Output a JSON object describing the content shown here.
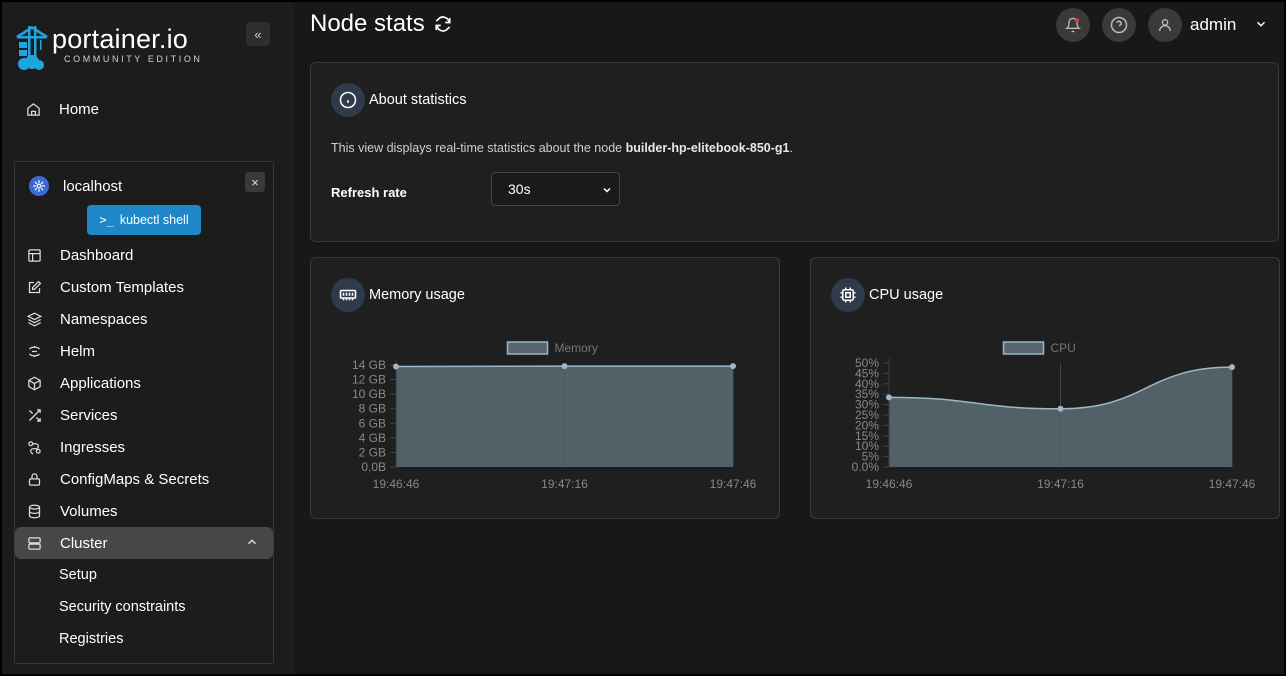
{
  "brand": {
    "name": "portainer.io",
    "edition": "COMMUNITY EDITION"
  },
  "sidebar": {
    "home_label": "Home",
    "environment": {
      "name": "localhost",
      "kubectl_label": "kubectl shell",
      "items": [
        {
          "label": "Dashboard",
          "icon": "layout-icon"
        },
        {
          "label": "Custom Templates",
          "icon": "edit-icon"
        },
        {
          "label": "Namespaces",
          "icon": "layers-icon"
        },
        {
          "label": "Helm",
          "icon": "helm-icon"
        },
        {
          "label": "Applications",
          "icon": "box-icon"
        },
        {
          "label": "Services",
          "icon": "shuffle-icon"
        },
        {
          "label": "Ingresses",
          "icon": "route-icon"
        },
        {
          "label": "ConfigMaps & Secrets",
          "icon": "lock-icon"
        },
        {
          "label": "Volumes",
          "icon": "database-icon"
        },
        {
          "label": "Cluster",
          "icon": "server-icon"
        }
      ],
      "cluster_children": [
        "Setup",
        "Security constraints",
        "Registries"
      ]
    }
  },
  "header": {
    "title": "Node stats",
    "user": "admin"
  },
  "about": {
    "title": "About statistics",
    "text_prefix": "This view displays real-time statistics about the node ",
    "node_name": "builder-hp-elitebook-850-g1",
    "text_suffix": ".",
    "refresh_label": "Refresh rate",
    "refresh_value": "30s"
  },
  "memory_panel": {
    "title": "Memory usage"
  },
  "cpu_panel": {
    "title": "CPU usage"
  },
  "colors": {
    "accent": "#1d87c8",
    "series_fill": "#55646d",
    "series_line": "#9fb7c6"
  },
  "chart_data": [
    {
      "type": "area",
      "legend": "Memory",
      "x": [
        "19:46:46",
        "19:47:16",
        "19:47:46"
      ],
      "values": [
        13.8,
        13.85,
        13.85
      ],
      "yticks": [
        "0.0B",
        "2 GB",
        "4 GB",
        "6 GB",
        "8 GB",
        "10 GB",
        "12 GB",
        "14 GB"
      ],
      "ylim": [
        0,
        14
      ],
      "legend_position": "top"
    },
    {
      "type": "area",
      "legend": "CPU",
      "x": [
        "19:46:46",
        "19:47:16",
        "19:47:46"
      ],
      "values": [
        33.5,
        28,
        48
      ],
      "yticks": [
        "0.0%",
        "5%",
        "10%",
        "15%",
        "20%",
        "25%",
        "30%",
        "35%",
        "40%",
        "45%",
        "50%"
      ],
      "ylim": [
        0,
        50
      ],
      "legend_position": "top"
    }
  ]
}
